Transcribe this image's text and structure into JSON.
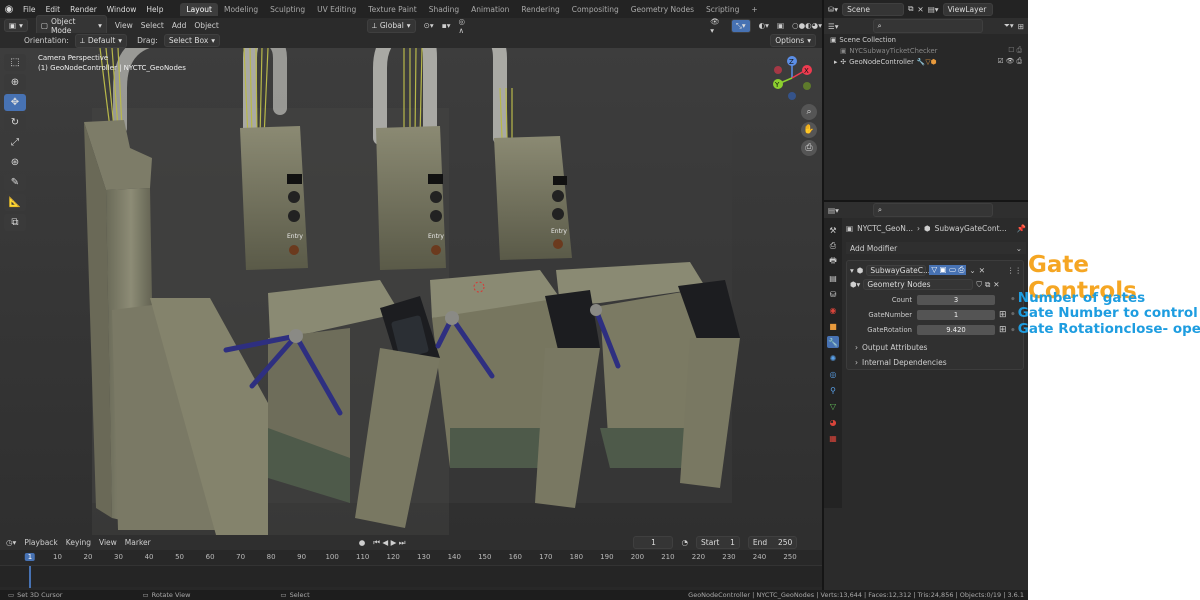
{
  "top_menu": [
    "File",
    "Edit",
    "Render",
    "Window",
    "Help"
  ],
  "workspaces": [
    "Layout",
    "Modeling",
    "Sculpting",
    "UV Editing",
    "Texture Paint",
    "Shading",
    "Animation",
    "Rendering",
    "Compositing",
    "Geometry Nodes",
    "Scripting"
  ],
  "active_workspace": "Layout",
  "scene_name": "Scene",
  "viewlayer_name": "ViewLayer",
  "header": {
    "mode": "Object Mode",
    "menus": [
      "View",
      "Select",
      "Add",
      "Object"
    ],
    "transform_space": "Global",
    "orientation_label": "Orientation:",
    "orientation_value": "Default",
    "drag_label": "Drag:",
    "drag_value": "Select Box",
    "options": "Options"
  },
  "viewport": {
    "camera_line1": "Camera Perspective",
    "camera_line2": "(1) GeoNodeController | NYCTC_GeoNodes",
    "gizmo_axes": {
      "x": "X",
      "y": "Y",
      "z": "Z"
    },
    "entry_label": "Entry"
  },
  "timeline": {
    "menus": [
      "Playback",
      "Keying",
      "View",
      "Marker"
    ],
    "current_frame": "1",
    "start_label": "Start",
    "start_value": "1",
    "end_label": "End",
    "end_value": "250",
    "ticks": [
      "1",
      "10",
      "20",
      "30",
      "40",
      "50",
      "60",
      "70",
      "80",
      "90",
      "100",
      "110",
      "120",
      "130",
      "140",
      "150",
      "160",
      "170",
      "180",
      "190",
      "200",
      "210",
      "220",
      "230",
      "240",
      "250"
    ]
  },
  "statusbar": {
    "left1": "Set 3D Cursor",
    "left2": "Rotate View",
    "left3": "Select",
    "right": "GeoNodeController | NYCTC_GeoNodes | Verts:13,644 | Faces:12,312 | Tris:24,856 | Objects:0/19 | 3.6.1"
  },
  "outliner": {
    "root": "Scene Collection",
    "items": [
      {
        "label": "NYCSubwayTicketChecker",
        "dim": true
      },
      {
        "label": "GeoNodeController",
        "dim": false
      }
    ]
  },
  "properties": {
    "breadcrumb_obj": "NYCTC_GeoN...",
    "breadcrumb_mod": "SubwayGateCont...",
    "add_modifier": "Add Modifier",
    "modifier_name": "SubwayGateC...",
    "node_group": "Geometry Nodes",
    "inputs": [
      {
        "label": "Count",
        "value": "3"
      },
      {
        "label": "GateNumber",
        "value": "1"
      },
      {
        "label": "GateRotation",
        "value": "9.420"
      }
    ],
    "panels": [
      "Output Attributes",
      "Internal Dependencies"
    ]
  },
  "annotation": {
    "title": "Gate Controls",
    "items": [
      "Number of gates",
      "Gate Number to control",
      "Gate Rotationclose- open"
    ]
  },
  "colors": {
    "accent": "#4772b3",
    "annotation_title": "#f5a623",
    "annotation_item": "#1e9de0"
  }
}
